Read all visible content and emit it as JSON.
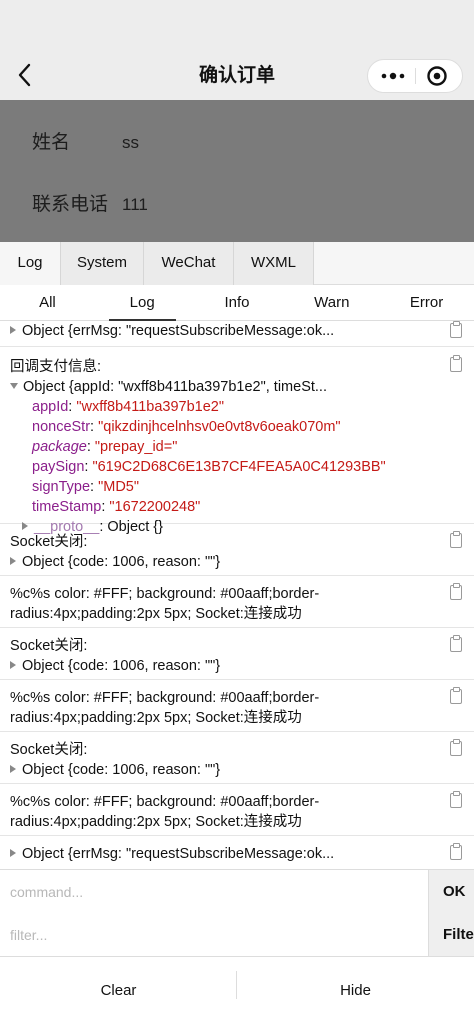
{
  "navbar": {
    "title": "确认订单"
  },
  "form": {
    "name_label": "姓名",
    "name_value": "ss",
    "phone_label": "联系电话",
    "phone_value": "111"
  },
  "console": {
    "panel_tabs": [
      "Log",
      "System",
      "WeChat",
      "WXML"
    ],
    "active_panel_tab": "Log",
    "level_tabs": [
      "All",
      "Log",
      "Info",
      "Warn",
      "Error"
    ],
    "active_level_tab": "Log",
    "logs": {
      "e1": "Object {errMsg: \"requestSubscribeMessage:ok...",
      "e2_title": "回调支付信息:",
      "e2_object": "Object {appId: \"wxff8b411ba397b1e2\", timeSt...",
      "e2_props": [
        {
          "key": "appId",
          "value": "\"wxff8b411ba397b1e2\""
        },
        {
          "key": "nonceStr",
          "value": "\"qikzdinjhcelnhsv0e0vt8v6oeak070m\""
        },
        {
          "key": "package",
          "value": "\"prepay_id=\""
        },
        {
          "key": "paySign",
          "value": "\"619C2D68C6E13B7CF4FEA5A0C41293BB\""
        },
        {
          "key": "signType",
          "value": "\"MD5\""
        },
        {
          "key": "timeStamp",
          "value": "\"1672200248\""
        }
      ],
      "e2_proto_key": "__proto__",
      "e2_proto_value": "Object {}",
      "socket_closed": "Socket关闭:",
      "socket_closed_obj": "Object {code: 1006, reason: \"\"}",
      "style_line1": "%c%s color: #FFF; background: #00aaff;border-",
      "style_line2": "radius:4px;padding:2px 5px; Socket:连接成功",
      "last": "Object {errMsg: \"requestSubscribeMessage:ok..."
    },
    "command_placeholder": "command...",
    "ok_label": "OK",
    "filter_placeholder": "filter...",
    "filter_label": "Filter",
    "clear_label": "Clear",
    "hide_label": "Hide"
  },
  "colors": {
    "navbar_bg": "#ededed",
    "mask_bg": "#7b7b7b",
    "prop_key": "#8b1f8b",
    "prop_value": "#c41a16"
  }
}
